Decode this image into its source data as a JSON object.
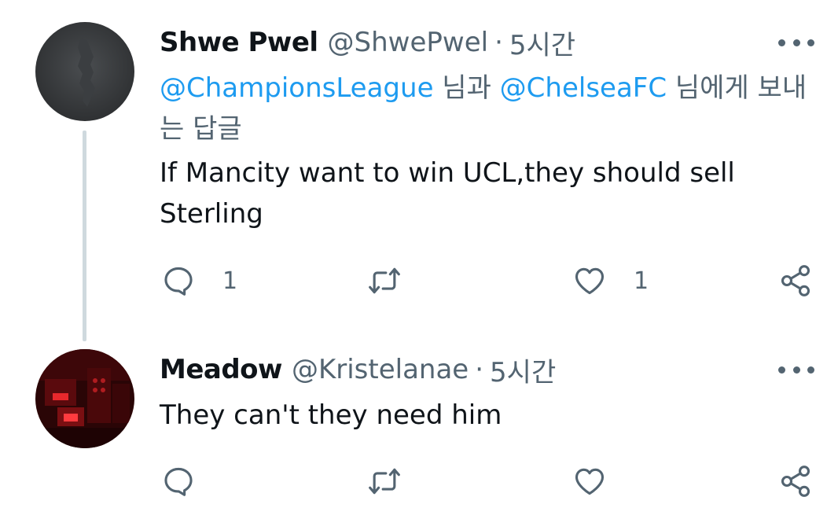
{
  "tweets": [
    {
      "author_name": "Shwe Pwel",
      "handle": "@ShwePwel",
      "separator": "·",
      "time": "5시간",
      "reply_to": {
        "mention_1": "@ChampionsLeague",
        "joiner": " 님과 ",
        "mention_2": "@ChelseaFC",
        "suffix": " 님에게 보내는 답글"
      },
      "text": "If Mancity want to win UCL,they should sell Sterling",
      "reply_count": "1",
      "like_count": "1"
    },
    {
      "author_name": "Meadow",
      "handle": "@Kristelanae",
      "separator": "·",
      "time": "5시간",
      "text": "They can't they need him"
    }
  ],
  "icons": {
    "reply": "speech-bubble-icon",
    "retweet": "retweet-arrows-icon",
    "like": "heart-icon",
    "share": "share-nodes-icon",
    "more": "more-dots-icon"
  },
  "colors": {
    "text": "#0f1419",
    "secondary": "#536471",
    "link": "#1d9bf0",
    "thread_line": "#cfd9de"
  }
}
